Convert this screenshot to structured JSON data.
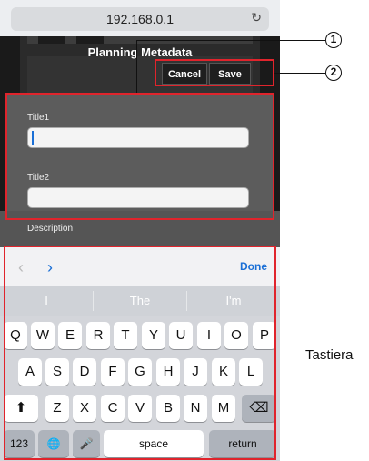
{
  "browser": {
    "url": "192.168.0.1",
    "reload_glyph": "↻"
  },
  "app": {
    "title": "Planning Metadata",
    "cancel_label": "Cancel",
    "save_label": "Save",
    "title1_label": "Title1",
    "title1_value": "",
    "title2_label": "Title2",
    "title2_value": "",
    "description_label": "Description"
  },
  "keyboard": {
    "prev_glyph": "‹",
    "next_glyph": "›",
    "done_label": "Done",
    "suggestions": [
      "I",
      "The",
      "I'm"
    ],
    "row1": [
      "Q",
      "W",
      "E",
      "R",
      "T",
      "Y",
      "U",
      "I",
      "O",
      "P"
    ],
    "row2": [
      "A",
      "S",
      "D",
      "F",
      "G",
      "H",
      "J",
      "K",
      "L"
    ],
    "row3": [
      "Z",
      "X",
      "C",
      "V",
      "B",
      "N",
      "M"
    ],
    "shift_glyph": "⬆",
    "delete_glyph": "⌫",
    "numbers_label": "123",
    "globe_glyph": "🌐",
    "mic_glyph": "🎤",
    "space_label": "space",
    "return_label": "return"
  },
  "callouts": {
    "c1": "1",
    "c2": "2",
    "keyboard_label": "Tastiera"
  },
  "colors": {
    "highlight": "#e0242c",
    "done": "#1a6fd6"
  }
}
